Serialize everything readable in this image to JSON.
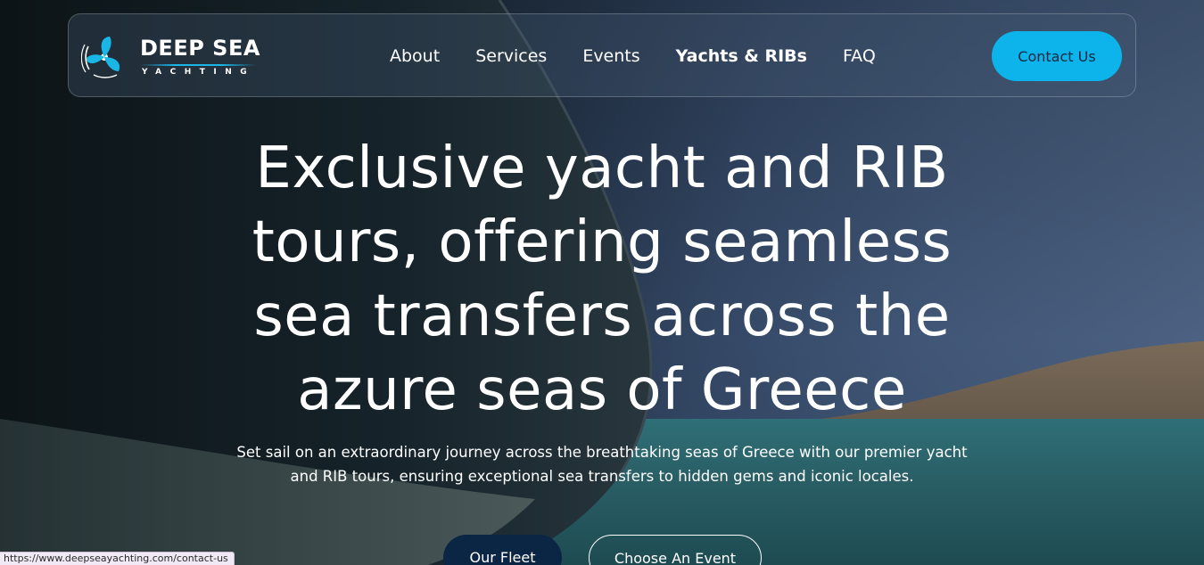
{
  "brand": {
    "name": "DEEP SEA",
    "tagline": "YACHTING",
    "accent_color": "#0db4ec",
    "logo_icon": "propeller-icon"
  },
  "nav": {
    "items": [
      {
        "label": "About"
      },
      {
        "label": "Services"
      },
      {
        "label": "Events"
      },
      {
        "label": "Yachts & RIBs"
      },
      {
        "label": "FAQ"
      }
    ],
    "contact_label": "Contact Us"
  },
  "hero": {
    "headline": "Exclusive yacht and RIB tours, offering seamless sea transfers across the azure seas of Greece",
    "subtext": "Set sail on an extraordinary journey across the breathtaking seas of Greece with our premier yacht and RIB tours, ensuring exceptional sea transfers to hidden gems and iconic locales.",
    "primary_button": "Our Fleet",
    "secondary_button": "Choose An Event"
  },
  "status_bar": {
    "url": "https://www.deepseayachting.com/contact-us"
  },
  "colors": {
    "primary_button_bg": "#0b2545",
    "contact_button_bg": "#0db4ec"
  }
}
